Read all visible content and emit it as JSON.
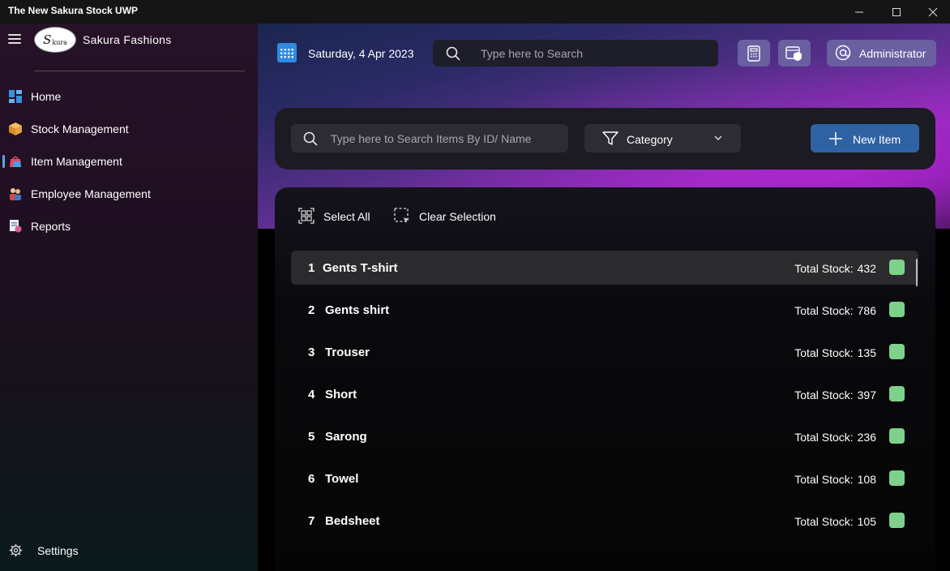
{
  "window": {
    "title": "The New Sakura Stock UWP",
    "minimize_icon": "minimize-icon",
    "maximize_icon": "maximize-icon",
    "close_icon": "close-icon"
  },
  "sidebar": {
    "logo_text": "S",
    "logo_sub": "kura",
    "brand": "Sakura Fashions",
    "items": [
      {
        "label": "Home",
        "icon": "home-icon"
      },
      {
        "label": "Stock Management",
        "icon": "box-icon"
      },
      {
        "label": "Item Management",
        "icon": "shopping-bag-icon",
        "selected": true
      },
      {
        "label": "Employee Management",
        "icon": "people-icon"
      },
      {
        "label": "Reports",
        "icon": "report-icon"
      }
    ],
    "settings_label": "Settings"
  },
  "header": {
    "date": "Saturday, 4 Apr 2023",
    "search_placeholder": "Type here to Search",
    "user_label": "Administrator"
  },
  "filters": {
    "search_placeholder": "Type here to Search Items By ID/ Name",
    "category_label": "Category",
    "new_item_label": "New Item"
  },
  "selection": {
    "select_all_label": "Select All",
    "clear_selection_label": "Clear Selection"
  },
  "stock_label": "Total Stock:",
  "items": [
    {
      "id": "1",
      "name": "Gents T-shirt",
      "stock": "432"
    },
    {
      "id": "2",
      "name": "Gents shirt",
      "stock": "786"
    },
    {
      "id": "3",
      "name": "Trouser",
      "stock": "135"
    },
    {
      "id": "4",
      "name": "Short",
      "stock": "397"
    },
    {
      "id": "5",
      "name": "Sarong",
      "stock": "236"
    },
    {
      "id": "6",
      "name": "Towel",
      "stock": "108"
    },
    {
      "id": "7",
      "name": "Bedsheet",
      "stock": "105"
    }
  ],
  "colors": {
    "accent": "#2f62a3",
    "status_badge": "#7ed18b",
    "selected_indicator": "#5aa5e8"
  }
}
